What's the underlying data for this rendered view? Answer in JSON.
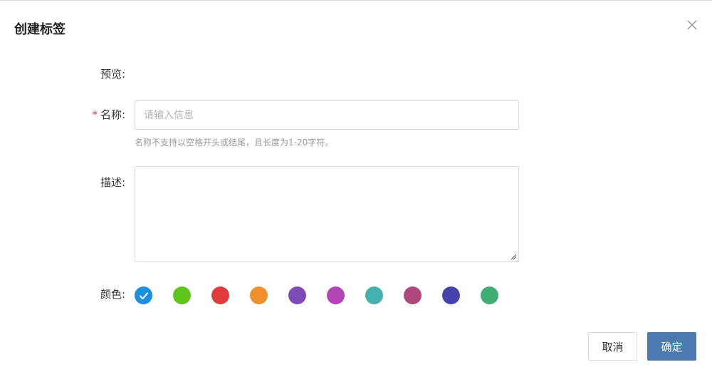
{
  "dialog": {
    "title": "创建标签",
    "close_icon": "close-icon"
  },
  "form": {
    "preview_label": "预览:",
    "name": {
      "required_mark": "*",
      "label": "名称:",
      "value": "",
      "placeholder": "请输入信息",
      "hint": "名称不支持以空格开头或结尾，且长度为1-20字符。"
    },
    "description": {
      "label": "描述:",
      "value": ""
    },
    "color": {
      "label": "颜色:",
      "selected_index": 0,
      "options": [
        "#1a8fe3",
        "#5ec51a",
        "#e03a3a",
        "#f0902a",
        "#7d4bb5",
        "#b246b8",
        "#43b1b0",
        "#b0467e",
        "#4643ad",
        "#3fae74"
      ]
    }
  },
  "footer": {
    "cancel_label": "取消",
    "confirm_label": "确定"
  },
  "colors": {
    "primary_button": "#4a7ab0",
    "required_star": "#e53935"
  }
}
